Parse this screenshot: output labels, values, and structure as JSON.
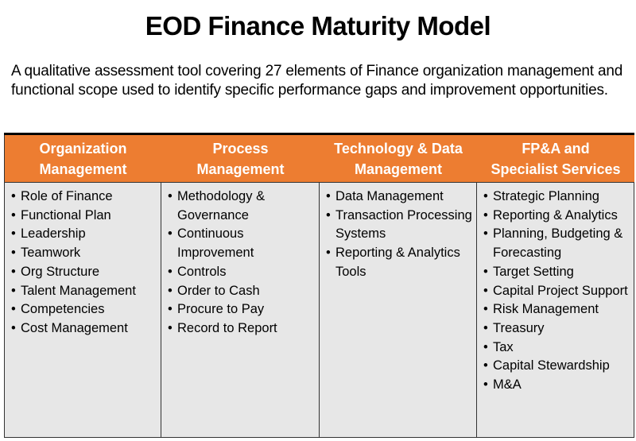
{
  "title": "EOD Finance Maturity Model",
  "description": "A qualitative assessment tool covering 27 elements of Finance organization management and functional scope used to identify specific performance gaps and improvement opportunities.",
  "colors": {
    "header_bg": "#ED7D31",
    "body_bg": "#E7E7E7"
  },
  "columns": [
    {
      "header_line1": "Organization",
      "header_line2": "Management",
      "items": [
        "Role of Finance",
        "Functional Plan",
        "Leadership",
        "Teamwork",
        "Org Structure",
        "Talent Management",
        "Competencies",
        "Cost Management"
      ]
    },
    {
      "header_line1": "Process",
      "header_line2": "Management",
      "items": [
        "Methodology & Governance",
        "Continuous Improvement",
        "Controls",
        "Order to Cash",
        "Procure to Pay",
        "Record to Report"
      ]
    },
    {
      "header_line1": "Technology & Data",
      "header_line2": "Management",
      "items": [
        "Data Management",
        "Transaction Processing Systems",
        "Reporting & Analytics Tools"
      ]
    },
    {
      "header_line1": "FP&A and",
      "header_line2": "Specialist Services",
      "items": [
        "Strategic Planning",
        "Reporting & Analytics",
        "Planning, Budgeting & Forecasting",
        "Target Setting",
        "Capital Project Support",
        "Risk Management",
        "Treasury",
        "Tax",
        "Capital Stewardship",
        "M&A"
      ]
    }
  ]
}
